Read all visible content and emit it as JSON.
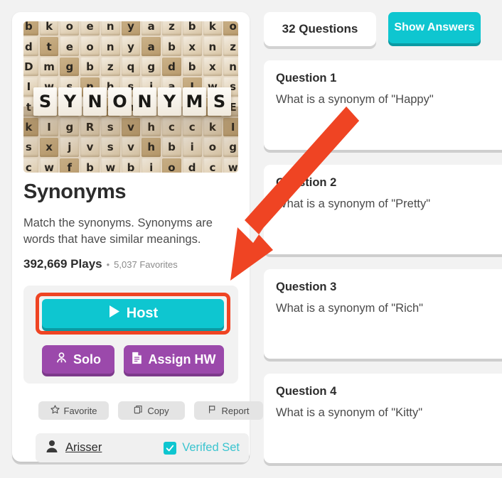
{
  "set": {
    "title": "Synonyms",
    "description": "Match the synonyms. Synonyms are words that have similar meanings.",
    "plays": "392,669 Plays",
    "separator": "•",
    "favorites": "5,037 Favorites",
    "thumbnail_word": "SYNONYMS",
    "thumbnail_letters": "bkoenyaz dteonyabxnz Dmgbzqgdbxn Iwsnhsia tEiwsnhoh kIgRsvhcc sxjvsvhbiog cwfbwbiod njnrxlida ntnefh"
  },
  "play_panel": {
    "host_label": "Host",
    "host_icon": "play-icon",
    "solo_label": "Solo",
    "solo_icon": "person-icon",
    "assign_hw_label": "Assign HW",
    "assign_hw_icon": "document-icon",
    "highlight_color": "#ef4423",
    "host_color": "#0ec6d0",
    "purple_color": "#9b49ab"
  },
  "actions": [
    {
      "label": "Favorite",
      "icon": "star-icon"
    },
    {
      "label": "Copy",
      "icon": "copy-icon"
    },
    {
      "label": "Report",
      "icon": "flag-icon"
    }
  ],
  "author": {
    "avatar_icon": "person-icon",
    "name": "Arisser",
    "verified_label": "Verifed Set",
    "verified_icon": "checkbox-checked-icon",
    "verified_color": "#3ac4cf"
  },
  "questions_header": {
    "count_label": "32 Questions",
    "show_answers_label": "Show Answers"
  },
  "questions": [
    {
      "title": "Question 1",
      "text": "What is a synonym of \"Happy\""
    },
    {
      "title": "Question 2",
      "text": "What is a synonym of \"Pretty\""
    },
    {
      "title": "Question 3",
      "text": "What is a synonym of \"Rich\""
    },
    {
      "title": "Question 4",
      "text": "What is a synonym of \"Kitty\""
    }
  ],
  "annotation": {
    "arrow_color": "#ef4423",
    "points_to": "host-button"
  }
}
